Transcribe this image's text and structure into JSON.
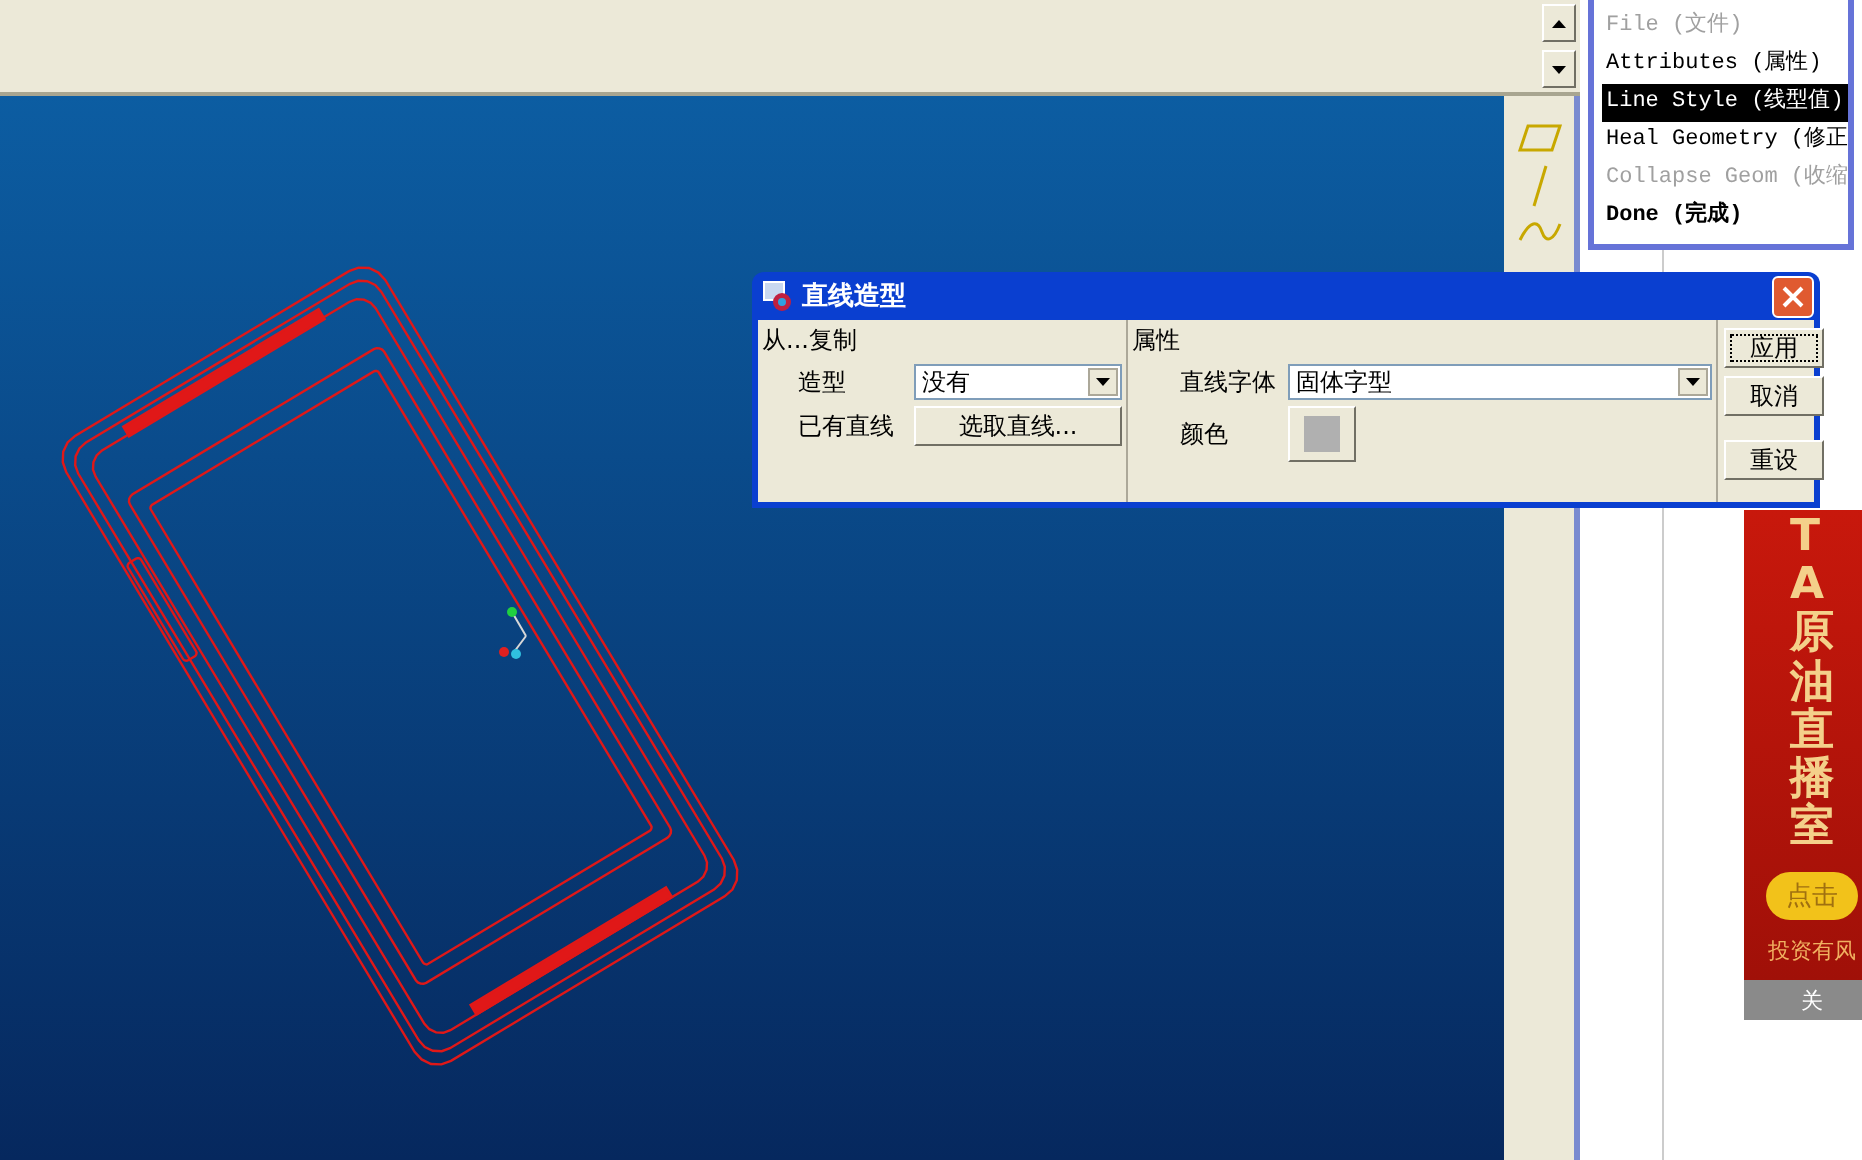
{
  "menu": {
    "items": [
      {
        "label": "File (文件)",
        "disabled": true,
        "selected": false,
        "emphasized": false
      },
      {
        "label": "Attributes (属性)",
        "disabled": false,
        "selected": false,
        "emphasized": false
      },
      {
        "label": "Line Style (线型值)",
        "disabled": false,
        "selected": true,
        "emphasized": false
      },
      {
        "label": "Heal Geometry (修正",
        "disabled": false,
        "selected": false,
        "emphasized": false
      },
      {
        "label": "Collapse Geom (收缩",
        "disabled": true,
        "selected": false,
        "emphasized": false
      },
      {
        "label": "Done (完成)",
        "disabled": false,
        "selected": false,
        "emphasized": true
      }
    ]
  },
  "dialog": {
    "title": "直线造型",
    "copy_group": {
      "title": "从...复制",
      "fields": [
        {
          "kind": "dropdown",
          "label": "造型",
          "value": "没有"
        },
        {
          "kind": "button",
          "label": "已有直线",
          "value": "选取直线..."
        }
      ]
    },
    "attributes_group": {
      "title": "属性",
      "fields": [
        {
          "kind": "dropdown",
          "label": "直线字体",
          "value": "固体字型"
        },
        {
          "kind": "color",
          "label": "颜色",
          "color": "#b0b0b0"
        }
      ]
    },
    "buttons": [
      {
        "label": "应用",
        "focused": true
      },
      {
        "label": "取消",
        "focused": false
      },
      {
        "label": "重设",
        "focused": false
      }
    ]
  },
  "ad": {
    "headline": "TA原油直播室",
    "button": "点击",
    "note": "投资有风",
    "close": "关"
  }
}
